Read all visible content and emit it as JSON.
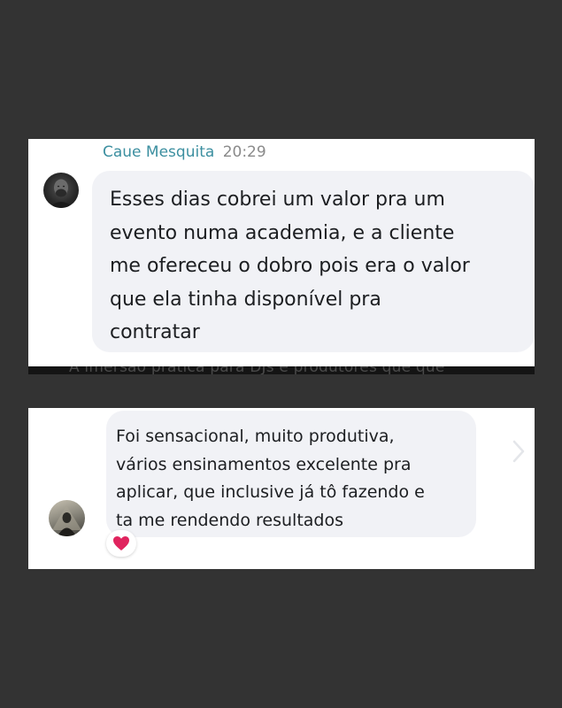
{
  "card1": {
    "sender_name": "Caue Mesquita",
    "time": "20:29",
    "message_lines": [
      "Esses dias cobrei um valor pra um",
      "evento numa academia, e a cliente",
      "me ofereceu o dobro pois era o valor",
      "que ela tinha disponível pra",
      "contratar"
    ]
  },
  "strip": {
    "text": "A imersão prática para DJs e produtores que que"
  },
  "card2": {
    "message_lines": [
      "Foi sensacional, muito produtiva,",
      "vários ensinamentos excelente pra",
      "aplicar, que inclusive já tô fazendo e",
      "ta me rendendo resultados"
    ],
    "reaction_icon": "heart-icon"
  },
  "colors": {
    "background": "#333333",
    "card": "#ffffff",
    "bubble": "#f1f2f6",
    "sender_name": "#3c8fa0",
    "timestamp": "#8a8a8a",
    "heart": "#e0245e"
  }
}
